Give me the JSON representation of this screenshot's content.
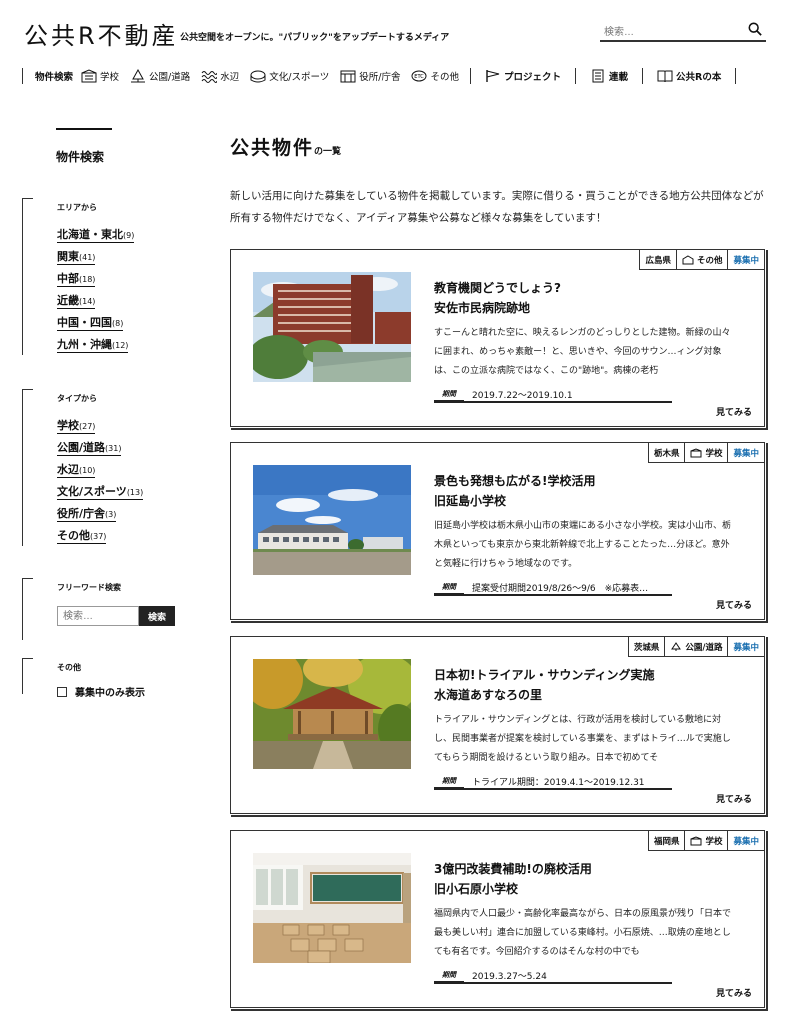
{
  "header": {
    "logo": "公共R不動産",
    "tagline": "公共空間をオープンに。\"パブリック\"をアップデートするメディア",
    "search_placeholder": "検索…"
  },
  "nav": {
    "label": "物件検索",
    "items": [
      "学校",
      "公園/道路",
      "水辺",
      "文化/スポーツ",
      "役所/庁舎",
      "その他"
    ],
    "links": [
      "プロジェクト",
      "連載",
      "公共Rの本"
    ]
  },
  "sidebar": {
    "title": "物件検索",
    "area": {
      "title": "エリアから",
      "items": [
        {
          "label": "北海道・東北",
          "count": "(9)"
        },
        {
          "label": "関東",
          "count": "(41)"
        },
        {
          "label": "中部",
          "count": "(18)"
        },
        {
          "label": "近畿",
          "count": "(14)"
        },
        {
          "label": "中国・四国",
          "count": "(8)"
        },
        {
          "label": "九州・沖縄",
          "count": "(12)"
        }
      ]
    },
    "type": {
      "title": "タイプから",
      "items": [
        {
          "label": "学校",
          "count": "(27)"
        },
        {
          "label": "公園/道路",
          "count": "(31)"
        },
        {
          "label": "水辺",
          "count": "(10)"
        },
        {
          "label": "文化/スポーツ",
          "count": "(13)"
        },
        {
          "label": "役所/庁舎",
          "count": "(3)"
        },
        {
          "label": "その他",
          "count": "(37)"
        }
      ]
    },
    "freeword": {
      "title": "フリーワード検索",
      "placeholder": "検索…",
      "button": "検索"
    },
    "other": {
      "title": "その他",
      "checkbox_label": "募集中のみ表示"
    }
  },
  "main": {
    "title": "公共物件",
    "title_suffix": "の一覧",
    "intro": "新しい活用に向けた募集をしている物件を掲載しています。実際に借りる・買うことができる地方公共団体などが所有する物件だけでなく、アイディア募集や公募など様々な募集をしています！",
    "period_label": "期間",
    "more_label": "見てみる",
    "cards": [
      {
        "pref": "広島県",
        "type": "その他",
        "status": "募集中",
        "title1": "教育機関どうでしょう?",
        "title2": "安佐市民病院跡地",
        "desc": "すこーんと晴れた空に、映えるレンガのどっしりとした建物。新緑の山々に囲まれ、めっちゃ素敵ー！と、思いきや、今回のサウン…ィング対象は、この立派な病院ではなく、この\"跡地\"。病棟の老朽",
        "period": "2019.7.22〜2019.10.1"
      },
      {
        "pref": "栃木県",
        "type": "学校",
        "status": "募集中",
        "title1": "景色も発想も広がる!学校活用",
        "title2": "旧延島小学校",
        "desc": "旧延島小学校は栃木県小山市の東端にある小さな小学校。実は小山市、栃木県といっても東京から東北新幹線で北上することたった…分ほど。意外と気軽に行けちゃう地域なのです。",
        "period": "提案受付期間2019/8/26〜9/6　※応募表…"
      },
      {
        "pref": "茨城県",
        "type": "公園/道路",
        "status": "募集中",
        "title1": "日本初!トライアル・サウンディング実施",
        "title2": "水海道あすなろの里",
        "desc": "トライアル・サウンディングとは、行政が活用を検討している敷地に対し、民間事業者が提案を検討している事業を、まずはトライ…ルで実施してもらう期間を設けるという取り組み。日本で初めてそ",
        "period": "トライアル期間：2019.4.1〜2019.12.31"
      },
      {
        "pref": "福岡県",
        "type": "学校",
        "status": "募集中",
        "title1": "3億円改装費補助!の廃校活用",
        "title2": "旧小石原小学校",
        "desc": "福岡県内で人口最少・高齢化率最高ながら、日本の原風景が残り「日本で最も美しい村」連合に加盟している東峰村。小石原焼、…取焼の産地としても有名です。今回紹介するのはそんな村の中でも",
        "period": "2019.3.27〜5.24"
      }
    ]
  }
}
